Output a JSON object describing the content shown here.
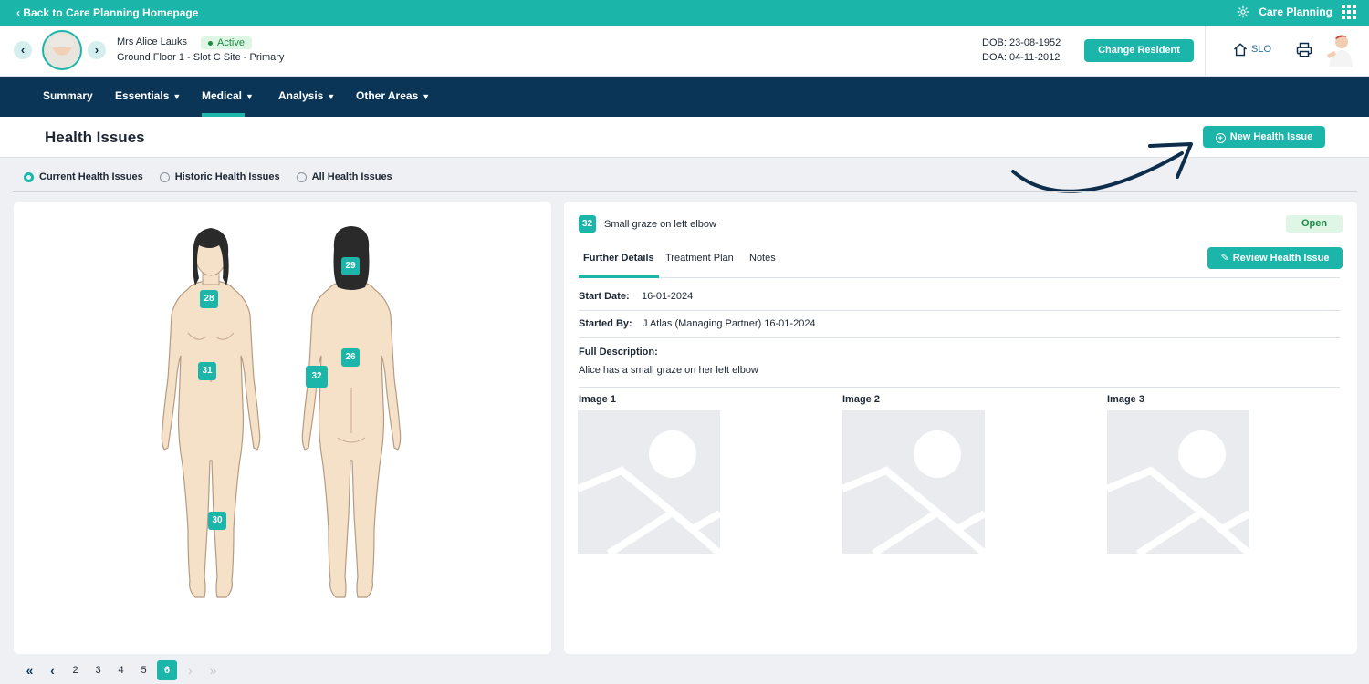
{
  "topbar": {
    "back_label": "‹ Back to Care Planning Homepage",
    "app_label": "Care Planning"
  },
  "resident": {
    "name": "Mrs Alice Lauks",
    "status": "Active",
    "location": "Ground Floor 1 - Slot C Site - Primary",
    "dob": "DOB: 23-08-1952",
    "doa": "DOA: 04-11-2012",
    "change_label": "Change Resident",
    "slo_label": "SLO"
  },
  "nav": {
    "items": [
      {
        "label": "Summary",
        "has_menu": false
      },
      {
        "label": "Essentials",
        "has_menu": true
      },
      {
        "label": "Medical",
        "has_menu": true,
        "active": true
      },
      {
        "label": "Analysis",
        "has_menu": true
      },
      {
        "label": "Other Areas",
        "has_menu": true
      }
    ]
  },
  "page": {
    "title": "Health Issues",
    "new_button": "New Health Issue"
  },
  "filters": {
    "options": [
      "Current Health Issues",
      "Historic Health Issues",
      "All Health Issues"
    ],
    "selected": "Current Health Issues"
  },
  "body_map": {
    "front_markers": [
      "28",
      "31",
      "30"
    ],
    "back_markers": [
      "29",
      "26",
      "32"
    ]
  },
  "issue": {
    "id": "32",
    "title": "Small graze on left elbow",
    "status": "Open",
    "tabs": [
      "Further Details",
      "Treatment Plan",
      "Notes"
    ],
    "active_tab": "Further Details",
    "review_button": "Review Health Issue",
    "start_date_label": "Start Date:",
    "start_date": "16-01-2024",
    "started_by_label": "Started By:",
    "started_by": "J Atlas (Managing Partner) 16-01-2024",
    "description_label": "Full Description:",
    "description": "Alice has a small graze on her left elbow",
    "images": [
      "Image 1",
      "Image 2",
      "Image 3"
    ]
  },
  "pagination": {
    "pages": [
      "2",
      "3",
      "4",
      "5",
      "6"
    ],
    "current": "6"
  },
  "colors": {
    "teal": "#1bb6a9",
    "navy": "#0b3556",
    "skin": "#f5e1c8"
  }
}
